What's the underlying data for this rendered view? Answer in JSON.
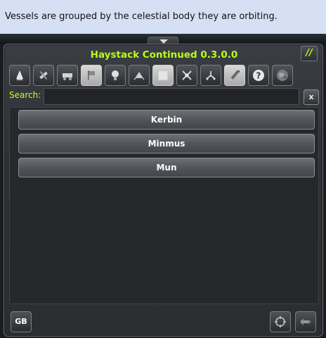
{
  "tooltip": "Vessels are grouped by the celestial body they are orbiting.",
  "window": {
    "title": "Haystack Continued 0.3.0.0",
    "resize_label": "//"
  },
  "toolbar": {
    "buttons": [
      {
        "icon": "lander-icon",
        "active": false
      },
      {
        "icon": "debris-icon",
        "active": false
      },
      {
        "icon": "rover-icon",
        "active": false
      },
      {
        "icon": "flag-icon",
        "active": true
      },
      {
        "icon": "probe-icon",
        "active": false
      },
      {
        "icon": "base-icon",
        "active": false
      },
      {
        "icon": "station-block-icon",
        "active": true
      },
      {
        "icon": "satellite-icon",
        "active": false
      },
      {
        "icon": "space-object-icon",
        "active": false
      },
      {
        "icon": "ship-icon",
        "active": true
      },
      {
        "icon": "help-icon",
        "active": false
      },
      {
        "icon": "planet-icon",
        "active": false
      }
    ]
  },
  "search": {
    "label": "Search:",
    "value": "",
    "placeholder": "",
    "clear_label": "x"
  },
  "groups": [
    {
      "label": "Kerbin"
    },
    {
      "label": "Minmus"
    },
    {
      "label": "Mun"
    }
  ],
  "footer": {
    "gb_label": "GB",
    "target_icon": "target-icon",
    "ship_icon": "ship-side-icon"
  },
  "colors": {
    "accent": "#b8ff1a",
    "tooltip_bg": "#d6e0f5",
    "window_bg": "#2e3034"
  }
}
